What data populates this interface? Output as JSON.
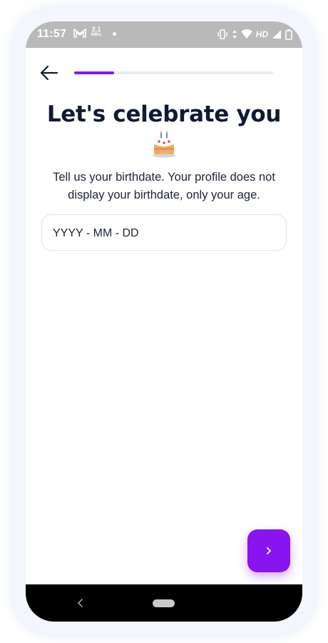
{
  "status_bar": {
    "time": "11:57",
    "network_speed_value": "2.1",
    "network_speed_unit": "MB/s",
    "network_label": "HD",
    "icons": [
      "gmail-icon",
      "vibrate-icon",
      "data-arrows-icon",
      "wifi-icon",
      "signal-icon",
      "battery-icon"
    ]
  },
  "header": {
    "back_icon": "arrow-left-icon",
    "progress_fraction": 0.2
  },
  "main": {
    "title": "Let's celebrate you",
    "title_icon": "birthday-cake-icon",
    "subtitle": "Tell us your birthdate. Your profile does not display your birthdate, only your age.",
    "date_input": {
      "placeholder": "YYYY - MM - DD",
      "value": ""
    }
  },
  "next_button": {
    "icon": "chevron-right-icon"
  },
  "nav_bar": {
    "back_icon": "nav-back-icon",
    "home_icon": "home-pill-icon"
  },
  "colors": {
    "accent": "#8a14f0",
    "title": "#101a33",
    "status_bar": "#b9b9b9",
    "nav_bar": "#000000"
  }
}
